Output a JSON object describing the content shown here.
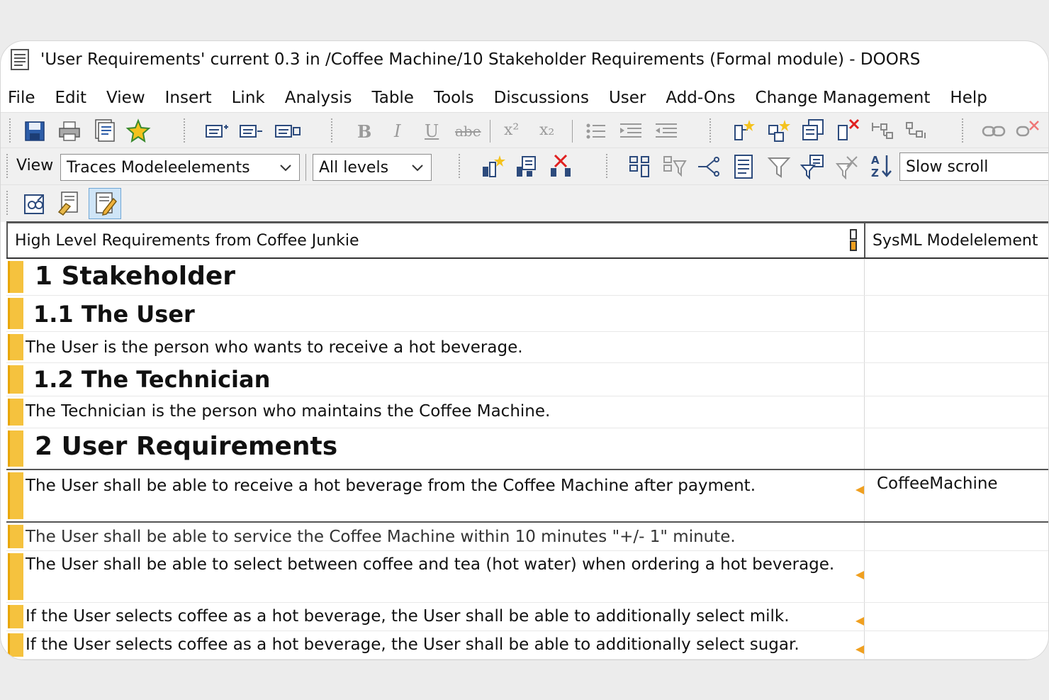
{
  "window": {
    "title": "'User Requirements' current 0.3 in /Coffee Machine/10 Stakeholder Requirements (Formal module) - DOORS"
  },
  "menu": [
    "File",
    "Edit",
    "View",
    "Insert",
    "Link",
    "Analysis",
    "Table",
    "Tools",
    "Discussions",
    "User",
    "Add-Ons",
    "Change Management",
    "Help"
  ],
  "toolbar_format": {
    "bold": "B",
    "italic": "I",
    "underline": "U",
    "strike": "abe",
    "superscript": "x²",
    "subscript": "x₂"
  },
  "view_bar": {
    "label": "View",
    "view_select": "Traces Modeleelements",
    "level_select": "All levels",
    "scroll_select": "Slow scroll"
  },
  "columns": {
    "main": "High Level Requirements from Coffee Junkie",
    "sysml": "SysML Modelelement"
  },
  "rows": [
    {
      "text": "1 Stakeholder",
      "style": "h1",
      "sysml": ""
    },
    {
      "text": "1.1 The User",
      "style": "h2",
      "sysml": ""
    },
    {
      "text": "The User is the person who wants to receive a hot beverage.",
      "style": "body",
      "sysml": ""
    },
    {
      "text": "1.2 The Technician",
      "style": "h2",
      "sysml": ""
    },
    {
      "text": "The Technician is the person who maintains the Coffee Machine.",
      "style": "body",
      "sysml": ""
    },
    {
      "text": "2 User Requirements",
      "style": "h1",
      "sysml": ""
    },
    {
      "text": "The User shall be able to receive a hot beverage from the Coffee Machine after payment.",
      "style": "body",
      "sysml": "CoffeeMachine",
      "link": true
    },
    {
      "text": "The User shall be able to service the Coffee Machine within 10 minutes \"+/- 1\" minute.",
      "style": "body",
      "sysml": ""
    },
    {
      "text": "The User shall be able to select between coffee and tea (hot water) when ordering a hot beverage.",
      "style": "body",
      "sysml": "",
      "link": true
    },
    {
      "text": "If the User selects coffee as a hot beverage, the User shall be able to additionally select milk.",
      "style": "body",
      "sysml": "",
      "link": true
    },
    {
      "text": "If the User selects coffee as a hot beverage, the User shall be able to additionally select sugar.",
      "style": "body",
      "sysml": "",
      "link": true
    }
  ],
  "colors": {
    "accent_bar": "#f5c23e",
    "link_arrow": "#f0a020",
    "selected_button": "#cfe5f7"
  }
}
